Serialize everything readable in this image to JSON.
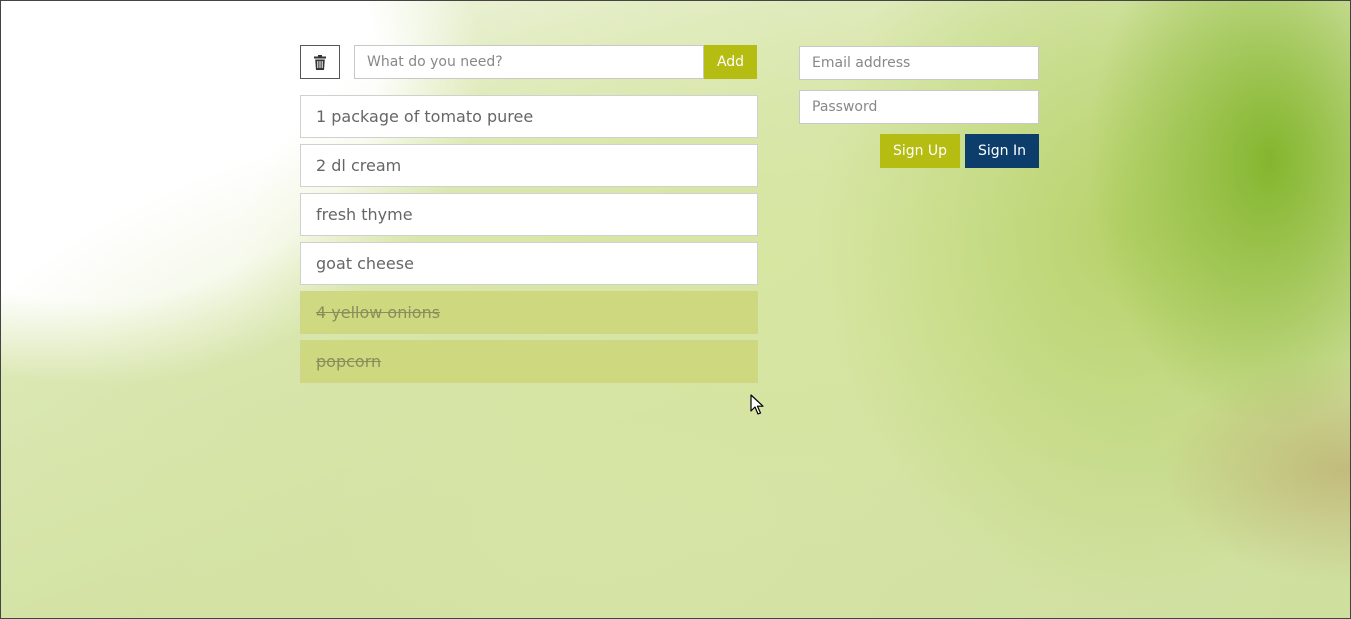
{
  "shopping_list": {
    "clear_button_icon": "trash-icon",
    "new_item": {
      "placeholder": "What do you need?",
      "value": ""
    },
    "add_label": "Add",
    "items": [
      {
        "text": "1 package of tomato puree",
        "done": false
      },
      {
        "text": "2 dl cream",
        "done": false
      },
      {
        "text": "fresh thyme",
        "done": false
      },
      {
        "text": "goat cheese",
        "done": false
      },
      {
        "text": "4 yellow onions",
        "done": true
      },
      {
        "text": "popcorn",
        "done": true
      }
    ]
  },
  "auth": {
    "email_placeholder": "Email address",
    "password_placeholder": "Password",
    "signup_label": "Sign Up",
    "signin_label": "Sign In"
  },
  "colors": {
    "accent": "#b5bc12",
    "signin": "#0c3d6b",
    "done_item": "#cdd678"
  }
}
